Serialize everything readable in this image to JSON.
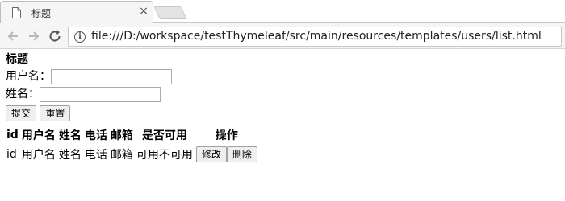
{
  "browser": {
    "tab_title": "标题",
    "tab_close": "×",
    "url": "file:///D:/workspace/testThymeleaf/src/main/resources/templates/users/list.html"
  },
  "page": {
    "heading": "标题",
    "form": {
      "username_label": "用户名：",
      "username_value": "",
      "name_label": "姓名：",
      "name_value": "",
      "submit_label": "提交",
      "reset_label": "重置"
    },
    "table": {
      "headers": [
        "id",
        "用户名",
        "姓名",
        "电话",
        "邮箱",
        "是否可用",
        "操作"
      ],
      "rows": [
        {
          "cells": [
            "id",
            "用户名",
            "姓名",
            "电话",
            "邮箱",
            "可用不可用"
          ],
          "edit_label": "修改",
          "delete_label": "删除"
        }
      ]
    }
  }
}
